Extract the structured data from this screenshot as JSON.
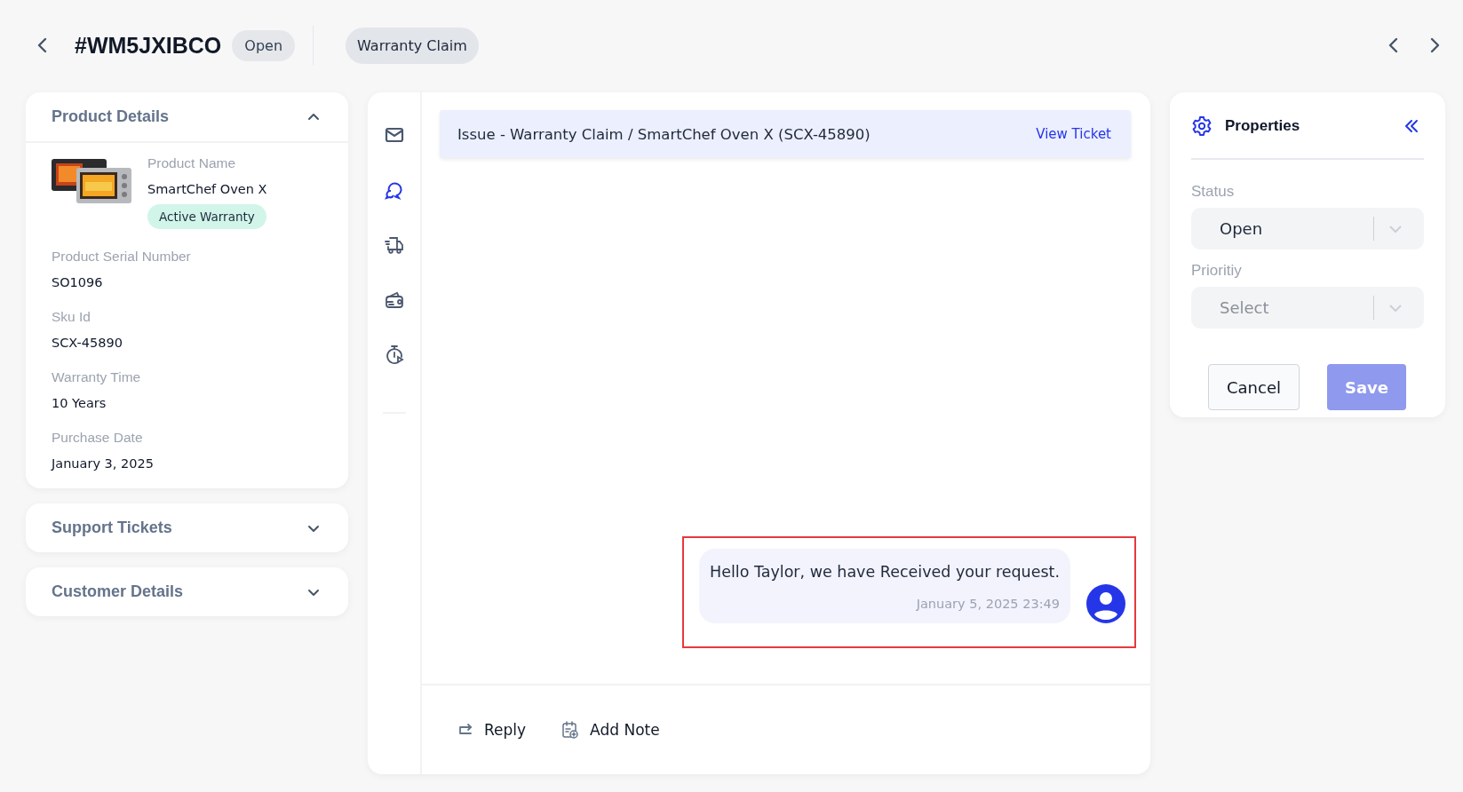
{
  "header": {
    "ticket_id": "#WM5JXIBCO",
    "status": "Open",
    "category": "Warranty Claim"
  },
  "panels": [
    {
      "title": "Product Details",
      "expanded": true,
      "product": {
        "name_label": "Product Name",
        "name": "SmartChef Oven X",
        "badge": "Active Warranty"
      },
      "fields": [
        {
          "label": "Product Serial Number",
          "value": "SO1096"
        },
        {
          "label": "Sku Id",
          "value": "SCX-45890"
        },
        {
          "label": "Warranty Time",
          "value": "10 Years"
        },
        {
          "label": "Purchase Date",
          "value": "January 3, 2025"
        }
      ]
    },
    {
      "title": "Support Tickets",
      "expanded": false
    },
    {
      "title": "Customer Details",
      "expanded": false
    }
  ],
  "channels": [
    {
      "kind": "mail",
      "selected": false
    },
    {
      "kind": "chat",
      "selected": true
    },
    {
      "kind": "truck",
      "selected": false
    },
    {
      "kind": "wallet",
      "selected": false
    },
    {
      "kind": "timer",
      "selected": false
    }
  ],
  "conversation": {
    "subject": "Issue - Warranty Claim / SmartChef Oven X (SCX-45890)",
    "link": "View Ticket",
    "messages": [
      {
        "text": "Hello Taylor, we have Received your request.",
        "time": "January 5, 2025 23:49",
        "highlighted": true
      }
    ],
    "actions": [
      {
        "kind": "reply",
        "label": "Reply"
      },
      {
        "kind": "note",
        "label": "Add Note"
      }
    ]
  },
  "properties": {
    "title": "Properties",
    "fields": [
      {
        "label": "Status",
        "value": "Open"
      },
      {
        "label": "Prioritiy",
        "placeholder": "Select"
      }
    ],
    "buttons": [
      {
        "label": "Cancel",
        "kind": "secondary",
        "disabled": false
      },
      {
        "label": "Save",
        "kind": "primary",
        "disabled": true
      }
    ]
  }
}
